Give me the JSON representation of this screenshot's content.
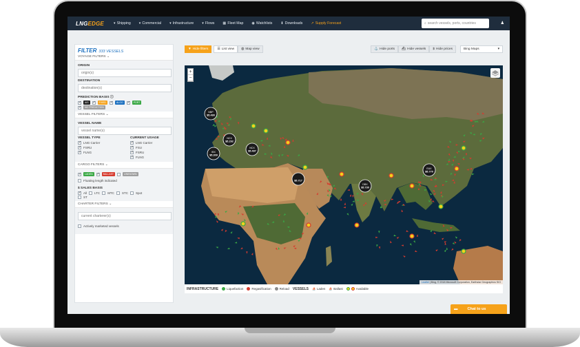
{
  "brand": {
    "name_prefix": "LNG",
    "name_suffix": "EDGE"
  },
  "nav": {
    "items": [
      {
        "label": "Shipping",
        "icon": "chevron-down-icon"
      },
      {
        "label": "Commercial",
        "icon": "chevron-down-icon"
      },
      {
        "label": "Infrastructure",
        "icon": "chevron-down-icon"
      },
      {
        "label": "Flows",
        "icon": "chevron-down-icon"
      },
      {
        "label": "Fleet Map",
        "icon": "map-icon"
      },
      {
        "label": "Watchlists",
        "icon": "eye-icon"
      },
      {
        "label": "Downloads",
        "icon": "download-icon"
      },
      {
        "label": "Supply Forecast",
        "icon": "chart-icon"
      }
    ],
    "search_placeholder": "search vessels, ports, countries",
    "user_icon": "user-icon"
  },
  "sidebar": {
    "title": "FILTER",
    "count": "333 VESSELS",
    "voyage_filters": "VOYAGE FILTERS",
    "origin_label": "ORIGIN",
    "origin_placeholder": "origin(s)",
    "destination_label": "DESTINATION",
    "destination_placeholder": "destination(s)",
    "prediction_label": "PREDICTION BASIS",
    "prediction_tags": [
      {
        "label": "AIS",
        "color": "#222222"
      },
      {
        "label": "FIXED",
        "color": "#f6a21a"
      },
      {
        "label": "ALGO",
        "color": "#1a6fbf"
      },
      {
        "label": "PORT",
        "color": "#3aa845"
      },
      {
        "label": "NO PREDICTION",
        "color": "#9e9e9e"
      }
    ],
    "vessel_filters": "VESSEL FILTERS",
    "vessel_name_label": "VESSEL NAME",
    "vessel_name_placeholder": "vessel name(s)",
    "vessel_type_label": "VESSEL TYPE",
    "vessel_types": [
      "LNG Carrier",
      "FSRU",
      "FLNG"
    ],
    "current_usage_label": "CURRENT USAGE",
    "current_usages": [
      "LNG Carrier",
      "FSU",
      "FSRU",
      "FLNG"
    ],
    "cargo_filters": "CARGO FILTERS",
    "cargo_tags": [
      {
        "label": "LADEN",
        "color": "#3aa845"
      },
      {
        "label": "BALLAST",
        "color": "#d63b2f"
      },
      {
        "label": "UNKNOWN",
        "color": "#9e9e9e"
      }
    ],
    "floating_label": "Floating length indicated",
    "sales_basis_label": "$ SALES BASIS",
    "sales_options": [
      "All",
      "LTC",
      "MTC",
      "STC",
      "Spot",
      "ST"
    ],
    "charter_filters": "CHARTER FILTERS",
    "charterer_placeholder": "current charterer(s)",
    "actively_marketed": "Actively marketed vessels"
  },
  "toolbar": {
    "hide_filters": "Hide filters",
    "list_view": "List view",
    "map_view": "Map view",
    "hide_ports": "Hide ports",
    "hide_vessels": "Hide vessels",
    "hide_prices": "Hide prices",
    "map_source": "Bing Maps"
  },
  "map": {
    "zoom_in": "+",
    "zoom_out": "−",
    "attribution_link": "Leaflet",
    "attribution_text": " | Bing, © 2018 Microsoft Corporation, Earthstar Geographics SIO",
    "price_markers": [
      {
        "label": "NBP",
        "price": "$5.490"
      },
      {
        "label": "NCX",
        "price": "$5.292"
      },
      {
        "label": "NCX",
        "price": "$5.497"
      },
      {
        "label": "IBX",
        "price": "$5.309"
      },
      {
        "label": "",
        "price": "$5.717"
      },
      {
        "label": "DBX",
        "price": "$5.730"
      },
      {
        "label": "EAX",
        "price": "$5.770"
      }
    ]
  },
  "legend": {
    "infrastructure_label": "INFRASTRUCTURE",
    "infrastructure": [
      {
        "label": "Liquefaction",
        "color": "#3aa845"
      },
      {
        "label": "Regasification",
        "color": "#d63b2f"
      },
      {
        "label": "Reload",
        "color": "#8a8a8a"
      }
    ],
    "vessels_label": "VESSELS",
    "vessels": [
      {
        "label": "Laden",
        "color": "#3aa845"
      },
      {
        "label": "Ballast",
        "color": "#d63b2f"
      },
      {
        "label": "Available",
        "color": "#f2d21b"
      }
    ]
  },
  "chat": {
    "label": "Chat to us",
    "icon": "chat-icon"
  }
}
